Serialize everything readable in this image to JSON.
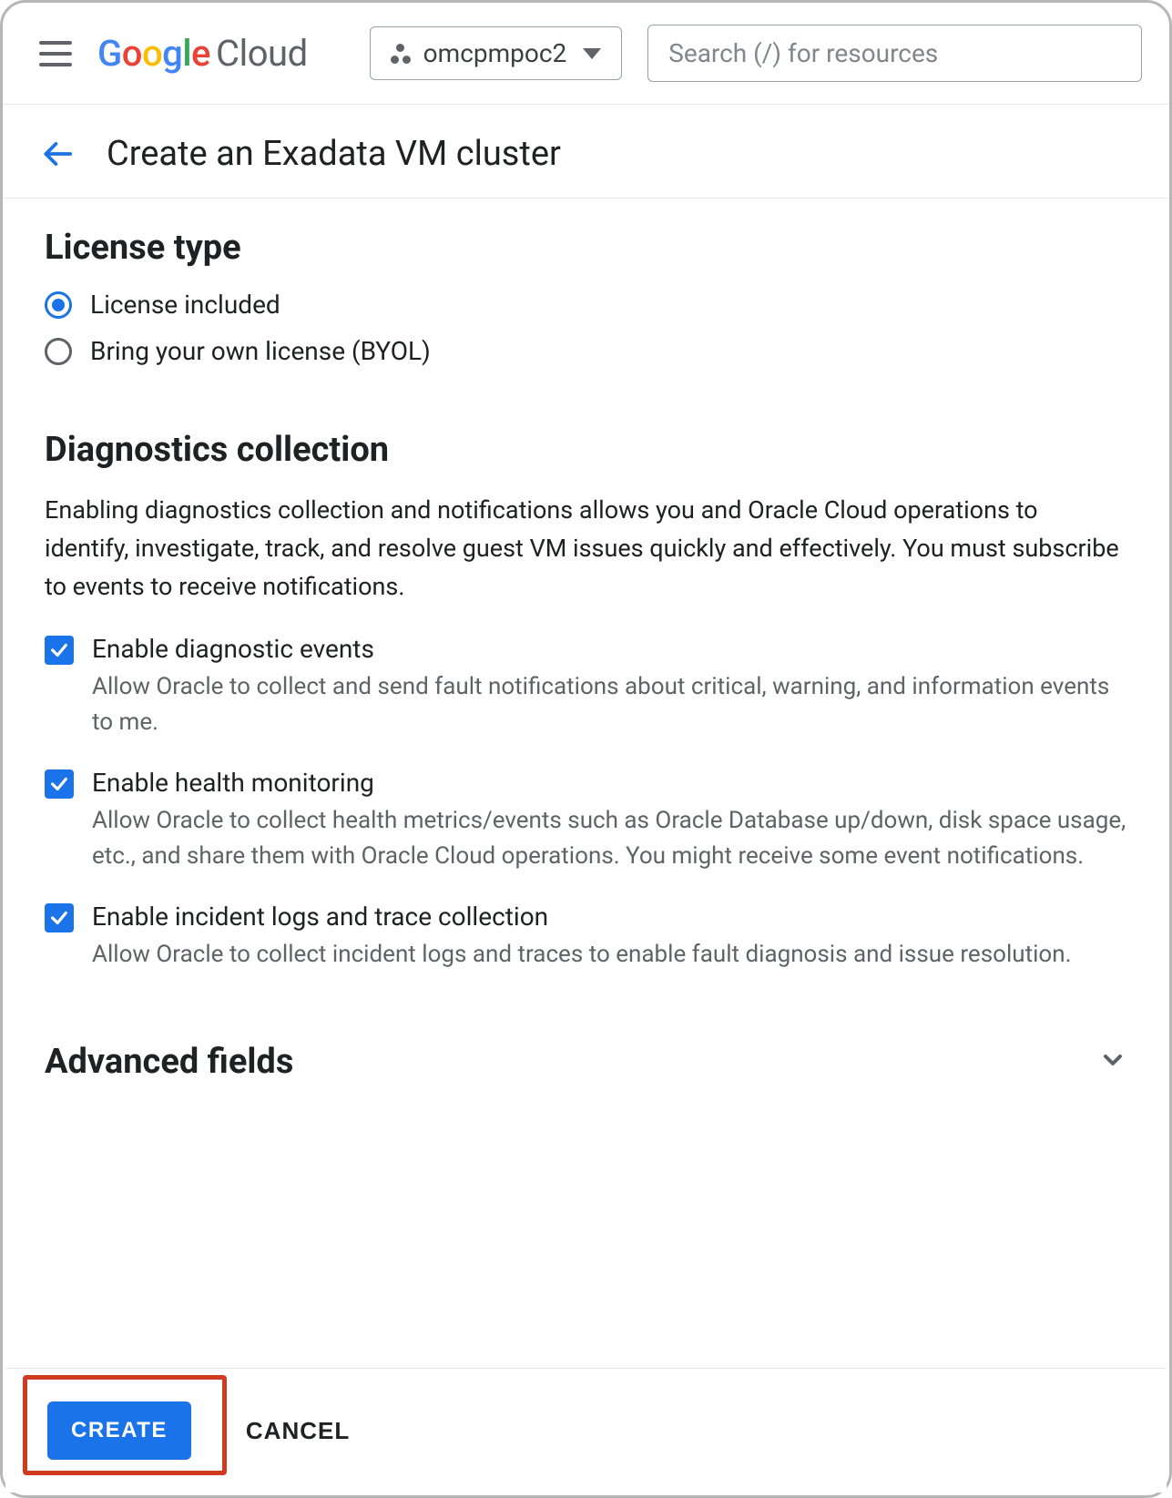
{
  "header": {
    "logo_product": "Cloud",
    "project_name": "omcpmpoc2",
    "search_placeholder": "Search (/) for resources"
  },
  "page": {
    "title": "Create an Exadata VM cluster"
  },
  "license": {
    "heading": "License type",
    "options": [
      {
        "id": "included",
        "label": "License included",
        "selected": true
      },
      {
        "id": "byol",
        "label": "Bring your own license (BYOL)",
        "selected": false
      }
    ]
  },
  "diagnostics": {
    "heading": "Diagnostics collection",
    "description": "Enabling diagnostics collection and notifications allows you and Oracle Cloud operations to identify, investigate, track, and resolve guest VM issues quickly and effectively. You must subscribe to events to receive notifications.",
    "items": [
      {
        "label": "Enable diagnostic events",
        "sub": "Allow Oracle to collect and send fault notifications about critical, warning, and information events to me.",
        "checked": true
      },
      {
        "label": "Enable health monitoring",
        "sub": "Allow Oracle to collect health metrics/events such as Oracle Database up/down, disk space usage, etc., and share them with Oracle Cloud operations. You might receive some event notifications.",
        "checked": true
      },
      {
        "label": "Enable incident logs and trace collection",
        "sub": "Allow Oracle to collect incident logs and traces to enable fault diagnosis and issue resolution.",
        "checked": true
      }
    ]
  },
  "advanced": {
    "heading": "Advanced fields"
  },
  "footer": {
    "create": "CREATE",
    "cancel": "CANCEL"
  }
}
